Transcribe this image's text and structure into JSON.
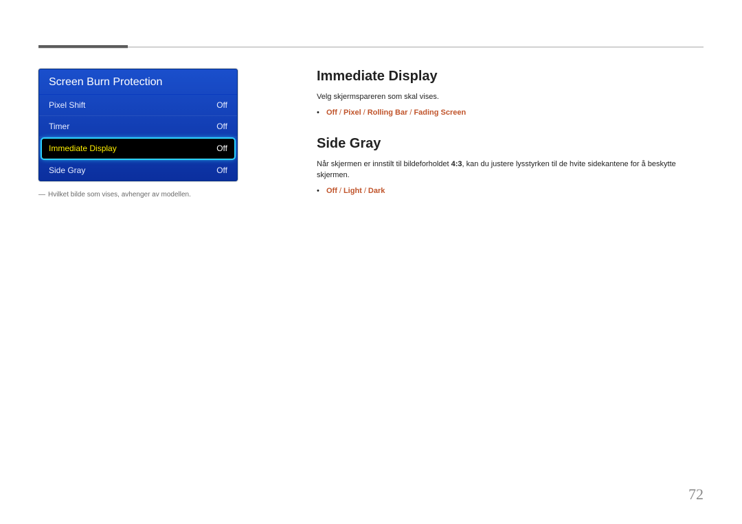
{
  "osd": {
    "title": "Screen Burn Protection",
    "rows": [
      {
        "label": "Pixel Shift",
        "value": "Off"
      },
      {
        "label": "Timer",
        "value": "Off"
      },
      {
        "label": "Immediate Display",
        "value": "Off"
      },
      {
        "label": "Side Gray",
        "value": "Off"
      }
    ]
  },
  "footnote": "Hvilket bilde som vises, avhenger av modellen.",
  "section1": {
    "title": "Immediate Display",
    "body": "Velg skjermspareren som skal vises.",
    "opts": [
      "Off",
      "Pixel",
      "Rolling Bar",
      "Fading Screen"
    ]
  },
  "section2": {
    "title": "Side Gray",
    "body_pre": "Når skjermen er innstilt til bildeforholdet ",
    "ratio": "4:3",
    "body_post": ", kan du justere lysstyrken til de hvite sidekantene for å beskytte skjermen.",
    "opts": [
      "Off",
      "Light",
      "Dark"
    ]
  },
  "page_number": "72"
}
